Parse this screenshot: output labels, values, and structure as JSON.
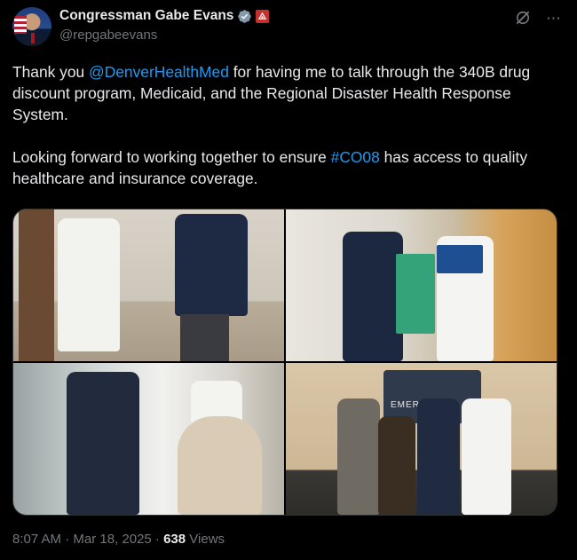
{
  "author": {
    "display_name": "Congressman Gabe Evans",
    "handle": "@repgabeevans"
  },
  "tweet": {
    "text_parts": {
      "p1_a": "Thank you ",
      "p1_mention": "@DenverHealthMed",
      "p1_b": " for having me to talk through the 340B drug discount program, Medicaid, and the Regional Disaster Health Response System.",
      "p2_a": "Looking forward to working together to ensure ",
      "p2_hashtag": "#CO08",
      "p2_b": " has access to quality healthcare and insurance coverage."
    },
    "photo_sign_text": "EMERGENCY",
    "timestamp": "8:07 AM · Mar 18, 2025 · ",
    "views_count": "638",
    "views_label": " Views"
  },
  "icons": {
    "verified": "verified-badge-icon",
    "gov": "government-badge-icon",
    "grok": "grok-icon",
    "more": "more-icon"
  },
  "colors": {
    "link": "#1d9bf0",
    "muted": "#71767b",
    "text": "#e7e9ea",
    "background": "#000000"
  }
}
